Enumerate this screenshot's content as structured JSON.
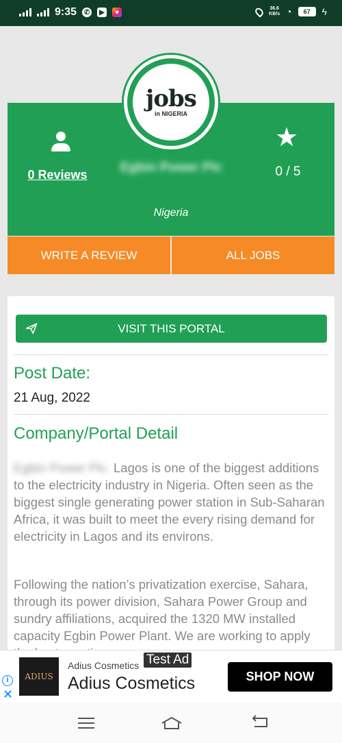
{
  "status": {
    "time": "9:35",
    "speed_value": "36.6",
    "speed_unit": "KB/s",
    "battery": "67"
  },
  "header": {
    "reviews_link": "0 Reviews",
    "company_name": "Egbin Power Plc",
    "rating": "0 / 5",
    "country": "Nigeria",
    "logo_text": "jobs",
    "logo_sub": "in NIGERIA"
  },
  "actions": {
    "write_review": "WRITE A REVIEW",
    "all_jobs": "ALL JOBS"
  },
  "content": {
    "visit_portal": "VISIT THIS PORTAL",
    "post_date_title": "Post Date:",
    "post_date": "21 Aug, 2022",
    "detail_title": "Company/Portal Detail",
    "para1_blurred": "Egbin Power Plc.",
    "para1": "Lagos is one of the biggest additions to the electricity industry in Nigeria. Often seen as the biggest single generating power station in Sub-Saharan Africa, it was built to meet the every rising demand for electricity in Lagos and its environs.",
    "para2": "Following the nation’s privatization exercise, Sahara, through its power division, Sahara Power Group and sundry affiliations, acquired the 1320 MW installed capacity Egbin Power Plant. We are working to apply the best practices"
  },
  "ad": {
    "logo_text": "ADIUS",
    "small_title": "Adius Cosmetics",
    "big_title": "Adius Cosmetics",
    "tag": "Test Ad",
    "cta": "SHOP NOW"
  }
}
